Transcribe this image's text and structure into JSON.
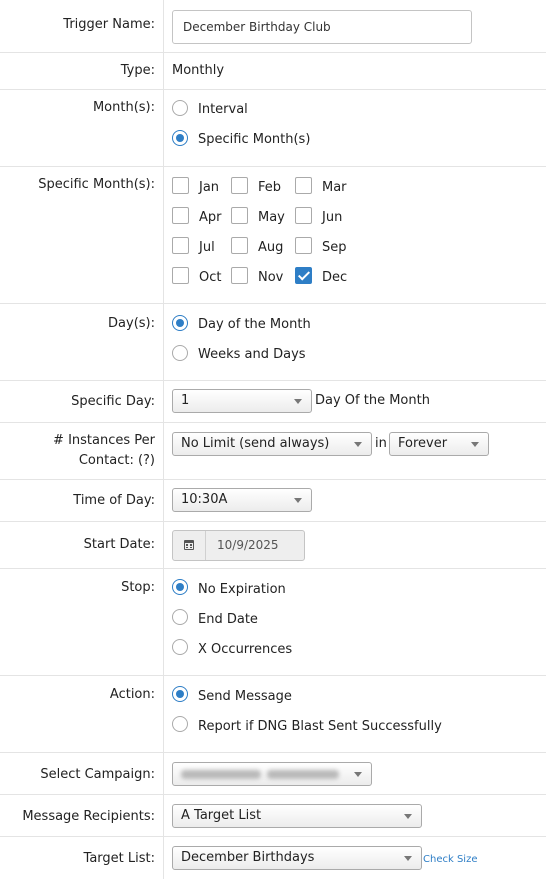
{
  "trigger_name": {
    "label": "Trigger Name:",
    "value": "December Birthday Club"
  },
  "type": {
    "label": "Type:",
    "value": "Monthly"
  },
  "months_mode": {
    "label": "Month(s):",
    "options": [
      "Interval",
      "Specific Month(s)"
    ],
    "selected": "Specific Month(s)"
  },
  "specific_months": {
    "label": "Specific Month(s):",
    "months": [
      "Jan",
      "Feb",
      "Mar",
      "Apr",
      "May",
      "Jun",
      "Jul",
      "Aug",
      "Sep",
      "Oct",
      "Nov",
      "Dec"
    ],
    "checked": [
      "Dec"
    ]
  },
  "days_mode": {
    "label": "Day(s):",
    "options": [
      "Day of the Month",
      "Weeks and Days"
    ],
    "selected": "Day of the Month"
  },
  "specific_day": {
    "label": "Specific Day:",
    "value": "1",
    "suffix": "Day Of the Month"
  },
  "instances": {
    "label_line1": "# Instances Per",
    "label_line2": "Contact: (?)",
    "limit_value": "No Limit (send always)",
    "in_label": "in",
    "period_value": "Forever"
  },
  "time_of_day": {
    "label": "Time of Day:",
    "value": "10:30A"
  },
  "start_date": {
    "label": "Start Date:",
    "value": "10/9/2025",
    "icon": "calendar-icon"
  },
  "stop": {
    "label": "Stop:",
    "options": [
      "No Expiration",
      "End Date",
      "X Occurrences"
    ],
    "selected": "No Expiration"
  },
  "action": {
    "label": "Action:",
    "options": [
      "Send Message",
      "Report if DNG Blast Sent Successfully"
    ],
    "selected": "Send Message"
  },
  "select_campaign": {
    "label": "Select Campaign:"
  },
  "message_recipients": {
    "label": "Message Recipients:",
    "value": "A Target List"
  },
  "target_list": {
    "label": "Target List:",
    "value": "December Birthdays",
    "link": "Check Size"
  },
  "colors": {
    "accent": "#2e7ec6",
    "border": "#e4e4e4",
    "link": "#2e7ec6"
  }
}
